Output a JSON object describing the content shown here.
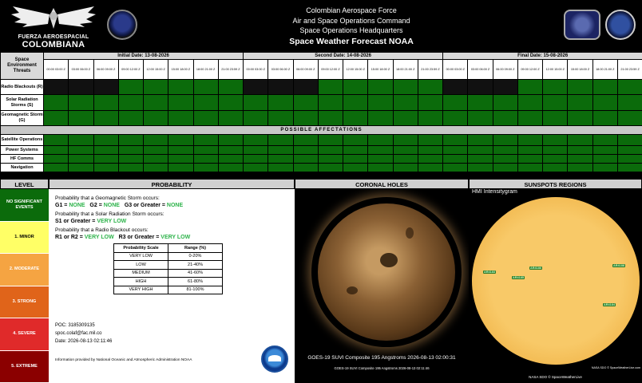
{
  "header": {
    "org_line1": "Colombian Aerospace Force",
    "org_line2": "Air and Space Operations Command",
    "org_line3": "Space Operations Headquarters",
    "title": "Space Weather Forecast NOAA",
    "logo_text_top": "FUERZA AEROESPACIAL",
    "logo_text_bottom": "COLOMBIANA"
  },
  "forecast": {
    "threats_header": "Space Environment Threats",
    "days": [
      {
        "label": "Initial Date: 13-08-2026"
      },
      {
        "label": "Second Date: 14-08-2026"
      },
      {
        "label": "Final Date: 15-08-2026"
      }
    ],
    "slots": [
      "00:00 03:00 Z",
      "03:00 06:00 Z",
      "06:00 09:00 Z",
      "09:00 12:00 Z",
      "12:00 15:00 Z",
      "15:00 18:00 Z",
      "18:00 21:00 Z",
      "21:00 23:59 Z"
    ],
    "threat_rows": [
      {
        "label": "Radio Blackouts (R)",
        "cells": [
          "k",
          "k",
          "k",
          "g",
          "g",
          "g",
          "g",
          "g",
          "k",
          "k",
          "k",
          "g",
          "g",
          "g",
          "g",
          "g",
          "k",
          "k",
          "k",
          "g",
          "g",
          "g",
          "g",
          "g"
        ]
      },
      {
        "label": "Solar Radiation Storms (S)",
        "cells": [
          "g",
          "g",
          "g",
          "g",
          "g",
          "g",
          "g",
          "g",
          "g",
          "g",
          "g",
          "g",
          "g",
          "g",
          "g",
          "g",
          "g",
          "g",
          "g",
          "g",
          "g",
          "g",
          "g",
          "g"
        ]
      },
      {
        "label": "Geomagnetic Storm (G)",
        "cells": [
          "g",
          "g",
          "g",
          "g",
          "g",
          "g",
          "g",
          "g",
          "g",
          "g",
          "g",
          "g",
          "g",
          "g",
          "g",
          "g",
          "g",
          "g",
          "g",
          "g",
          "g",
          "g",
          "g",
          "g"
        ]
      }
    ],
    "affectations_header": "POSSIBLE AFFECTATIONS",
    "affectation_rows": [
      {
        "label": "Satellite Operations"
      },
      {
        "label": "Power Systems"
      },
      {
        "label": "HF Comms"
      },
      {
        "label": "Navigation"
      }
    ]
  },
  "levels": {
    "header": "LEVEL",
    "items": [
      {
        "label": "NO SIGNIFICANT EVENTS",
        "bg": "#0b6b0b",
        "fg": "#ffffff"
      },
      {
        "label": "1. MINOR",
        "bg": "#ffff66",
        "fg": "#000000"
      },
      {
        "label": "2. MODERATE",
        "bg": "#f5a442",
        "fg": "#ffffff"
      },
      {
        "label": "3. STRONG",
        "bg": "#e0641a",
        "fg": "#ffffff"
      },
      {
        "label": "4. SEVERE",
        "bg": "#e02a2a",
        "fg": "#ffffff"
      },
      {
        "label": "5. EXTREME",
        "bg": "#8b0000",
        "fg": "#ffffff"
      }
    ]
  },
  "probability": {
    "header": "PROBABILITY",
    "q1": "Probability that a Geomagnetic Storm occurs:",
    "g1": "G1 = ",
    "g1v": "NONE",
    "g2": "G2 = ",
    "g2v": "NONE",
    "g3": "G3 or Greater = ",
    "g3v": "NONE",
    "q2": "Probability that a Solar Radiation Storm occurs:",
    "s1": "S1 or Greater = ",
    "s1v": "VERY LOW",
    "q3": "Probability that a Radio Blackout occurs:",
    "r1": "R1 or R2 = ",
    "r1v": "VERY LOW",
    "r3": "R3 or Greater = ",
    "r3v": "VERY LOW",
    "scale_header": [
      "Probability Scale",
      "Range (%)"
    ],
    "scale_rows": [
      [
        "VERY LOW",
        "0-20%"
      ],
      [
        "LOW",
        "21-40%"
      ],
      [
        "MEDIUM",
        "41-60%"
      ],
      [
        "HIGH",
        "61-80%"
      ],
      [
        "VERY HIGH",
        "81-100%"
      ]
    ],
    "poc": "POC: 3185309135",
    "email": "spoc.colaf@fac.mil.co",
    "date": "Date: 2026-08-13 02:11:46",
    "info": "Information provided by National Oceanic and Atmospheric Administration NOAA"
  },
  "coronal": {
    "header": "CORONAL HOLES",
    "caption1": "GOES-19 SUVI Composite 195 Angstroms 2026-08-13 02:00:31",
    "caption2": "GOES-19 SUVI Composite 195 Angstroms 2026-08-13 02:11:46"
  },
  "sunspots": {
    "header": "SUNSPOTS REGIONS",
    "image_title": "HMI Intensitygram",
    "credit_small": "NASA SDO © SpaceWeatherLive.com",
    "caption": "NASA SDO © SpaceWeatherLive",
    "regions": [
      {
        "label": "AR4183"
      },
      {
        "label": "AR4185"
      },
      {
        "label": "AR4186"
      },
      {
        "label": "AR4188"
      },
      {
        "label": "AR4184"
      }
    ]
  }
}
